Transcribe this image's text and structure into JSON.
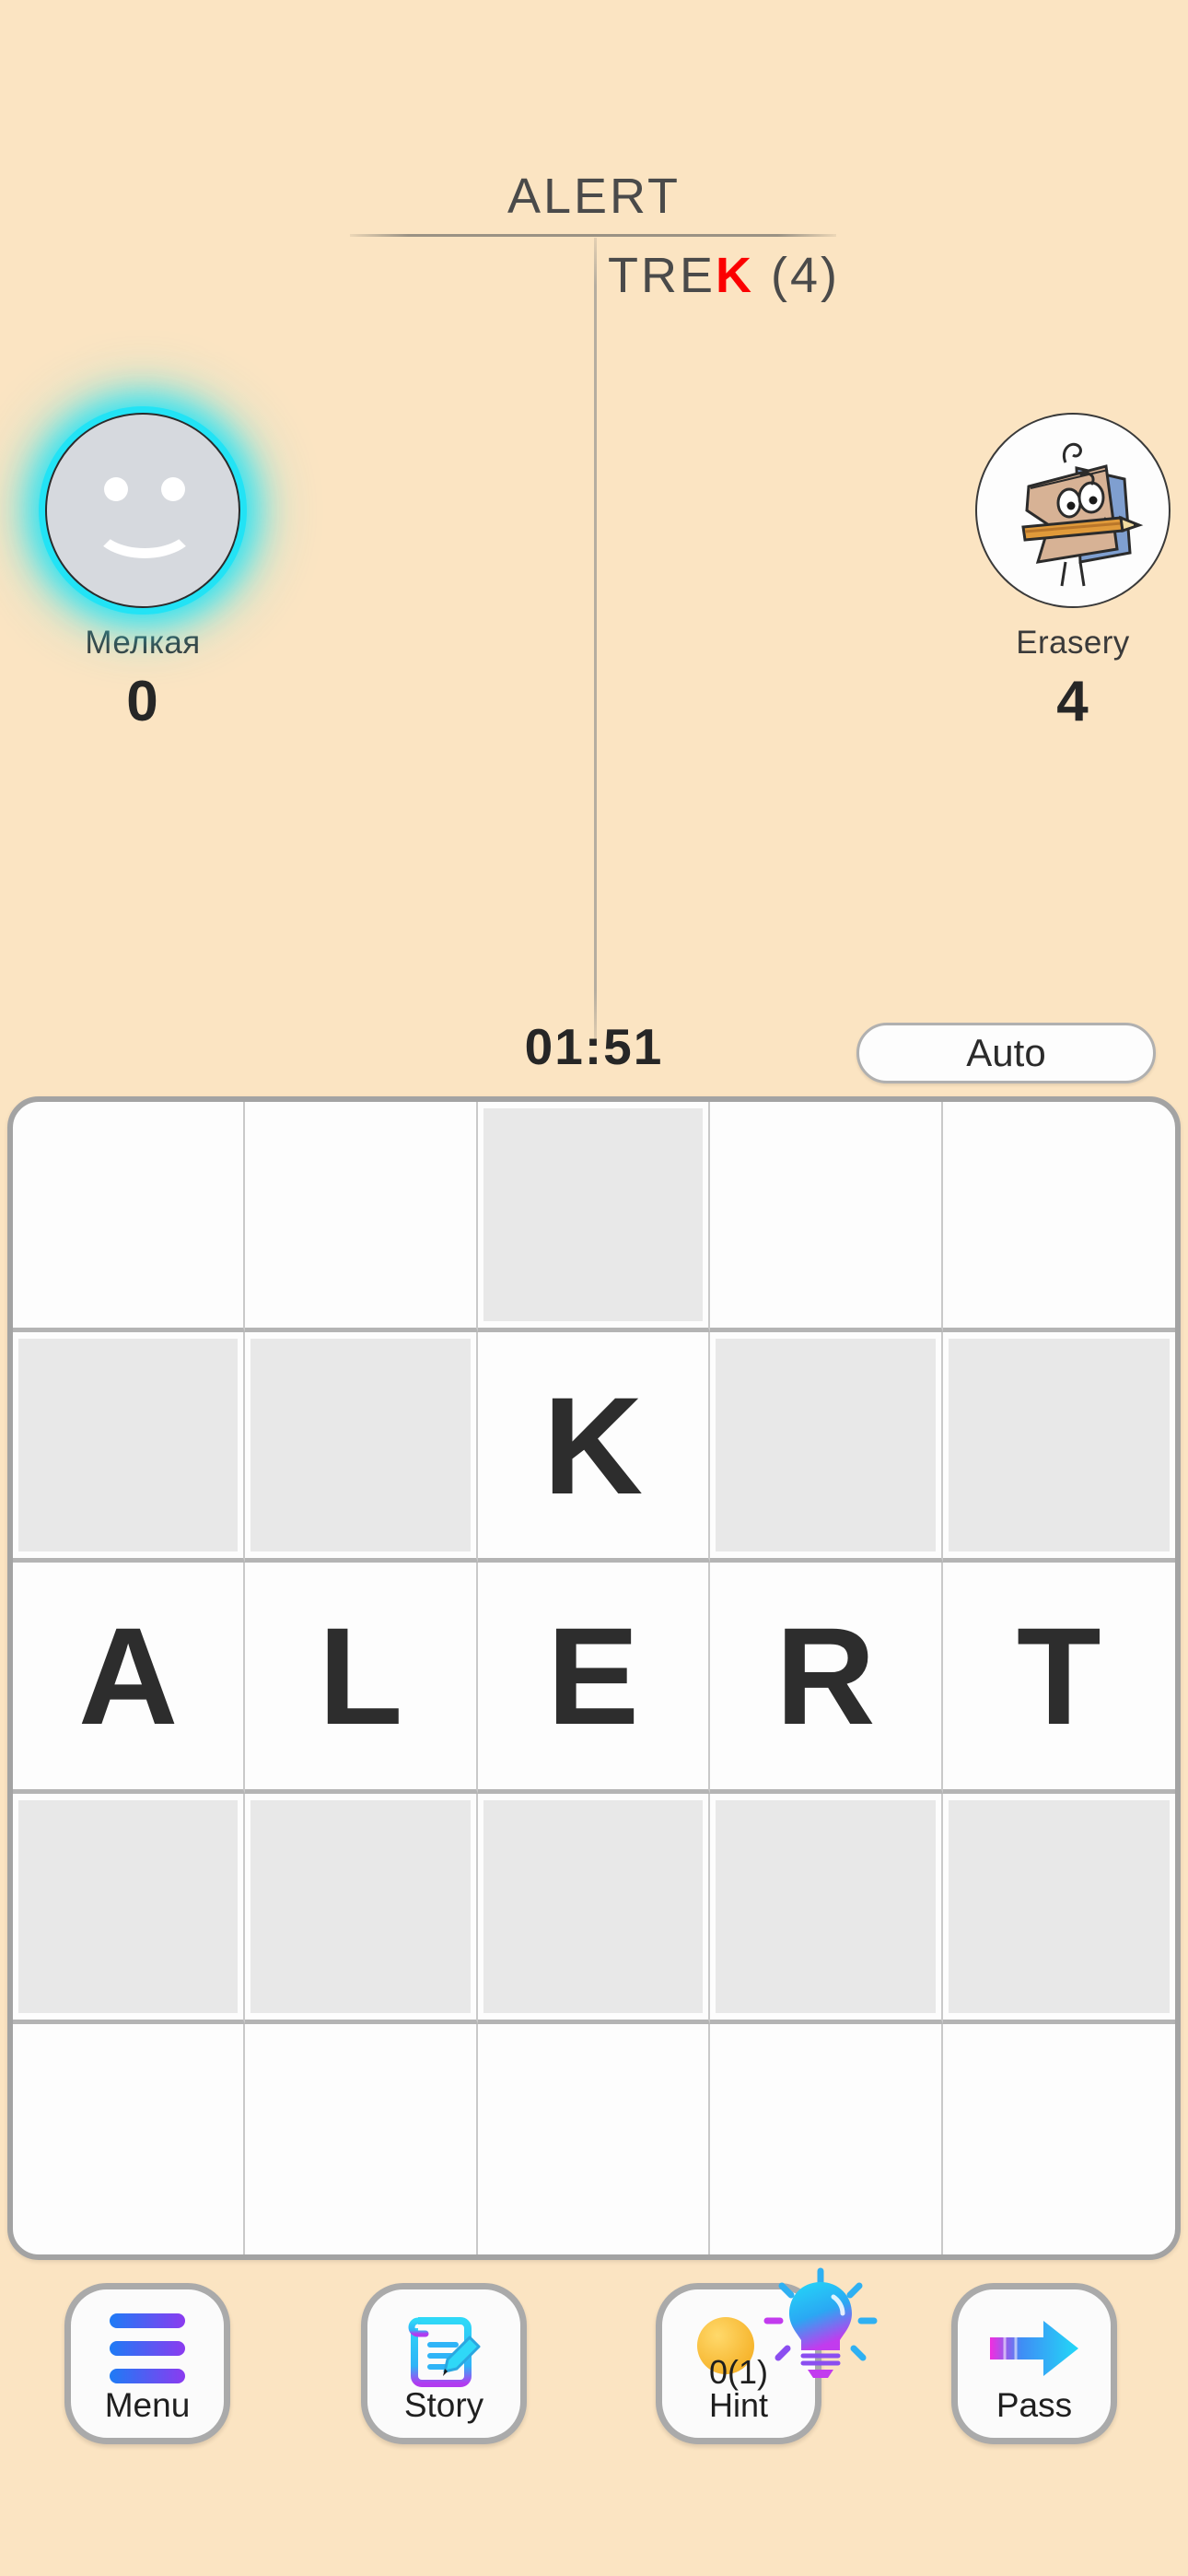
{
  "header": {
    "word_top": "ALERT",
    "word_bottom_prefix": "TRE",
    "word_bottom_highlight": "K",
    "word_bottom_suffix": " (4)",
    "highlight_color": "#fb0000"
  },
  "players": [
    {
      "name": "Мелкая",
      "score": "0",
      "avatar_type": "smiley",
      "active": true,
      "glow_color": "#22e3f5"
    },
    {
      "name": "Erasery",
      "score": "4",
      "avatar_type": "eraser-character",
      "active": false
    }
  ],
  "timer": "01:51",
  "auto_button": "Auto",
  "board": {
    "columns": 5,
    "rows": 5,
    "cells": [
      [
        {
          "letter": "",
          "filled": false
        },
        {
          "letter": "",
          "filled": false
        },
        {
          "letter": "",
          "filled": true
        },
        {
          "letter": "",
          "filled": false
        },
        {
          "letter": "",
          "filled": false
        }
      ],
      [
        {
          "letter": "",
          "filled": true
        },
        {
          "letter": "",
          "filled": true
        },
        {
          "letter": "K",
          "filled": false
        },
        {
          "letter": "",
          "filled": true
        },
        {
          "letter": "",
          "filled": true
        }
      ],
      [
        {
          "letter": "A",
          "filled": false
        },
        {
          "letter": "L",
          "filled": false
        },
        {
          "letter": "E",
          "filled": false
        },
        {
          "letter": "R",
          "filled": false
        },
        {
          "letter": "T",
          "filled": false
        }
      ],
      [
        {
          "letter": "",
          "filled": true
        },
        {
          "letter": "",
          "filled": true
        },
        {
          "letter": "",
          "filled": true
        },
        {
          "letter": "",
          "filled": true
        },
        {
          "letter": "",
          "filled": true
        }
      ],
      [
        {
          "letter": "",
          "filled": false
        },
        {
          "letter": "",
          "filled": false
        },
        {
          "letter": "",
          "filled": false
        },
        {
          "letter": "",
          "filled": false
        },
        {
          "letter": "",
          "filled": false
        }
      ]
    ]
  },
  "toolbar": {
    "menu": {
      "label": "Menu",
      "icon": "hamburger-icon"
    },
    "story": {
      "label": "Story",
      "icon": "document-pencil-icon"
    },
    "hint": {
      "count": "0(1)",
      "label": "Hint",
      "icon": "lightbulb-icon",
      "coin": "coin-icon"
    },
    "pass": {
      "label": "Pass",
      "icon": "arrow-right-icon"
    }
  },
  "colors": {
    "background": "#FBE4C2",
    "text": "#3a3a3a",
    "cell_filled": "#e8e8e8",
    "cell_empty": "#fdfdfd",
    "board_border": "#a3a3a3",
    "accent_gradient_start": "#1e7bf5",
    "accent_gradient_end": "#8b3bf0"
  }
}
